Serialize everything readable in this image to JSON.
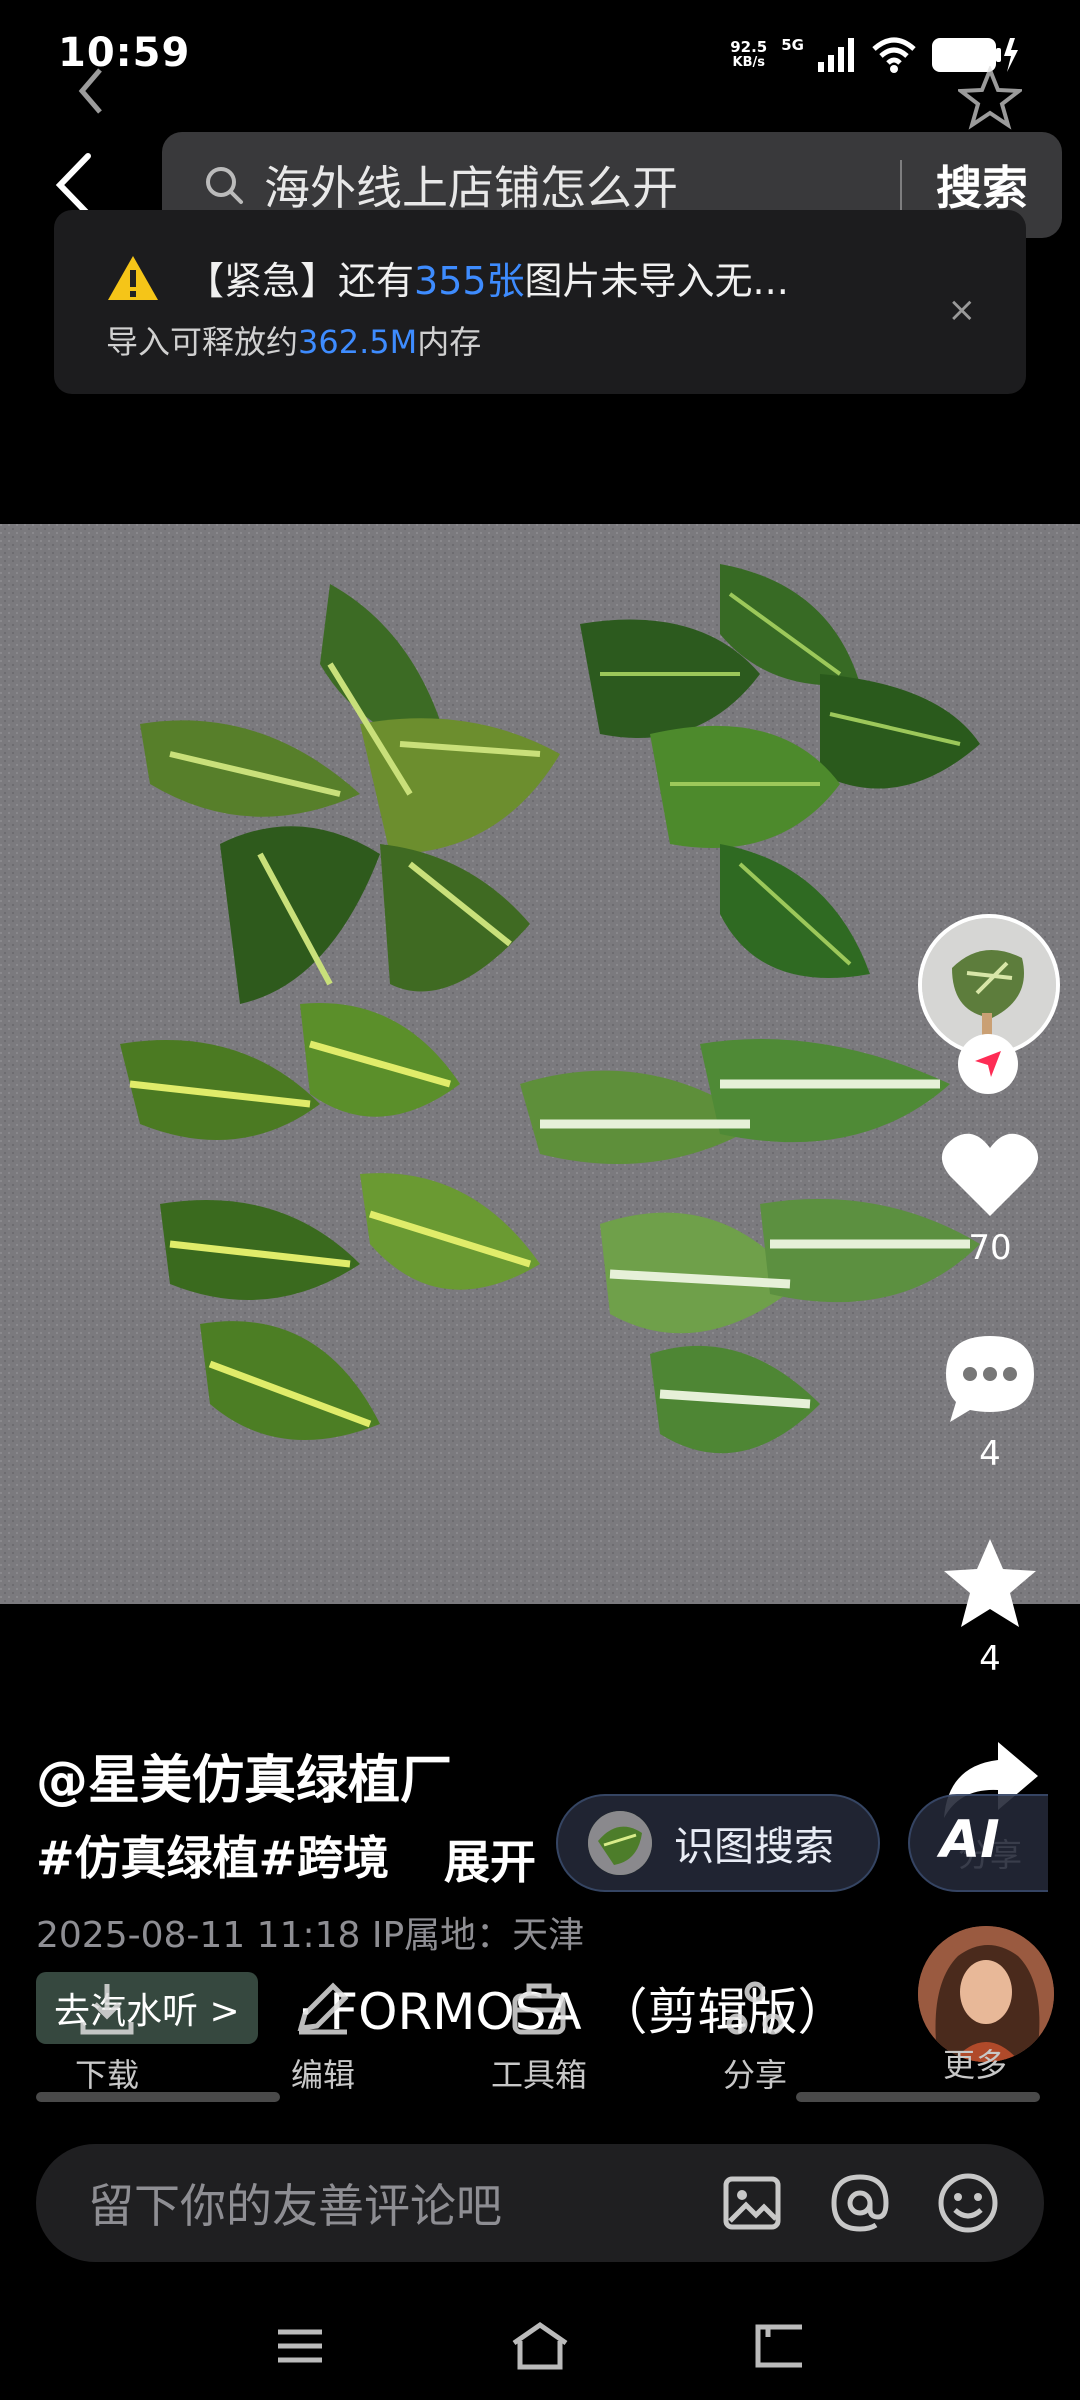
{
  "status_bar": {
    "time": "10:59",
    "net_speed_value": "92.5",
    "net_speed_unit": "KB/s",
    "signal_label": "5G"
  },
  "search": {
    "query": "海外线上店铺怎么开",
    "button_label": "搜索"
  },
  "notice": {
    "prefix": "【紧急】还有",
    "count": "355张",
    "suffix": "图片未导入无...",
    "line2_prefix": "导入可释放约",
    "line2_size": "362.5M",
    "line2_suffix": "内存",
    "close_glyph": "×"
  },
  "actions": {
    "like_count": "70",
    "comment_count": "4",
    "favorite_count": "4",
    "share_label": "分享"
  },
  "caption": {
    "author": "@星美仿真绿植厂",
    "tags": "#仿真绿植#跨境",
    "expand_label": "展开",
    "image_search_label": "识图搜索",
    "ai_label": "AI",
    "meta": "2025-08-11 11:18  IP属地：天津",
    "music_pill": "去汽水听 >",
    "music_title": "· FORMOSA  （剪辑版）"
  },
  "tools": {
    "download": "下载",
    "edit": "编辑",
    "toolbox": "工具箱",
    "share": "分享",
    "more": "更多"
  },
  "comment_bar": {
    "placeholder": "留下你的友善评论吧"
  },
  "colors": {
    "highlight": "#3e8cff",
    "background": "#000000",
    "warning": "#f5c518"
  }
}
